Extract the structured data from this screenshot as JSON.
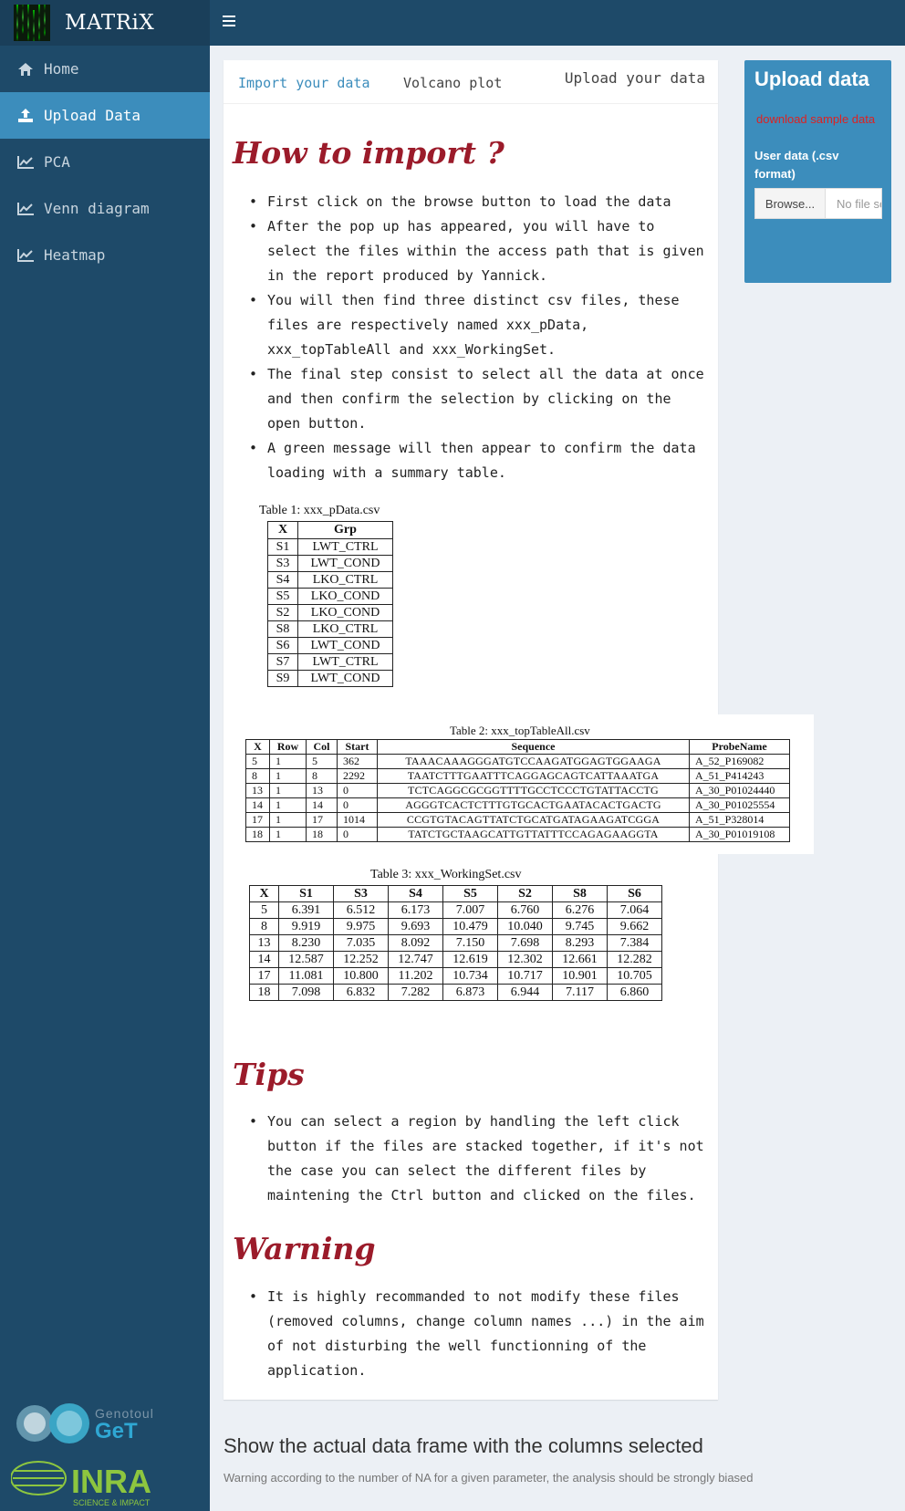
{
  "app": {
    "brand": "MATRiX"
  },
  "sidebar": {
    "items": [
      {
        "label": "Home",
        "icon": "home-icon"
      },
      {
        "label": "Upload Data",
        "icon": "upload-icon"
      },
      {
        "label": "PCA",
        "icon": "line-chart-icon"
      },
      {
        "label": "Venn diagram",
        "icon": "line-chart-icon"
      },
      {
        "label": "Heatmap",
        "icon": "line-chart-icon"
      }
    ],
    "logos": {
      "genotoul_top": "Genotoul",
      "genotoul_bottom": "GeT",
      "inra": "INRA",
      "inra_tag": "SCIENCE & IMPACT"
    }
  },
  "tabs": {
    "items": [
      "Import your data",
      "Volcano plot"
    ],
    "box_title": "Upload your data"
  },
  "howto": {
    "title": "How to import ?",
    "bullets": [
      "First click on the browse button to load the data",
      "After the pop up has appeared, you will have to select the files within the access path that is given in the report produced by Yannick.",
      "You will then find three distinct csv files, these files are respectively named xxx_pData, xxx_topTableAll and xxx_WorkingSet.",
      "The final step consist to select all the data at once and then confirm the selection by clicking on the open button.",
      "A green message will then appear to confirm the data loading with a summary table."
    ]
  },
  "table1": {
    "caption": "Table 1: xxx_pData.csv",
    "headers": [
      "X",
      "Grp"
    ],
    "rows": [
      [
        "S1",
        "LWT_CTRL"
      ],
      [
        "S3",
        "LWT_COND"
      ],
      [
        "S4",
        "LKO_CTRL"
      ],
      [
        "S5",
        "LKO_COND"
      ],
      [
        "S2",
        "LKO_COND"
      ],
      [
        "S8",
        "LKO_CTRL"
      ],
      [
        "S6",
        "LWT_COND"
      ],
      [
        "S7",
        "LWT_CTRL"
      ],
      [
        "S9",
        "LWT_COND"
      ]
    ]
  },
  "table2": {
    "caption": "Table 2: xxx_topTableAll.csv",
    "headers": [
      "X",
      "Row",
      "Col",
      "Start",
      "Sequence",
      "ProbeName"
    ],
    "rows": [
      [
        "5",
        "1",
        "5",
        "362",
        "TAAACAAAGGGATGTCCAAGATGGAGTGGAAGA",
        "A_52_P169082"
      ],
      [
        "8",
        "1",
        "8",
        "2292",
        "TAATCTTTGAATTTCAGGAGCAGTCATTAAATGA",
        "A_51_P414243"
      ],
      [
        "13",
        "1",
        "13",
        "0",
        "TCTCAGGCGCGGTTTTGCCTCCCTGTATTACCTG",
        "A_30_P01024440"
      ],
      [
        "14",
        "1",
        "14",
        "0",
        "AGGGTCACTCTTTGTGCACTGAATACACTGACTG",
        "A_30_P01025554"
      ],
      [
        "17",
        "1",
        "17",
        "1014",
        "CCGTGTACAGTTATCTGCATGATAGAAGATCGGA",
        "A_51_P328014"
      ],
      [
        "18",
        "1",
        "18",
        "0",
        "TATCTGCTAAGCATTGTTATTTCCAGAGAAGGTA",
        "A_30_P01019108"
      ]
    ]
  },
  "table3": {
    "caption": "Table 3: xxx_WorkingSet.csv",
    "headers": [
      "X",
      "S1",
      "S3",
      "S4",
      "S5",
      "S2",
      "S8",
      "S6"
    ],
    "rows": [
      [
        "5",
        "6.391",
        "6.512",
        "6.173",
        "7.007",
        "6.760",
        "6.276",
        "7.064"
      ],
      [
        "8",
        "9.919",
        "9.975",
        "9.693",
        "10.479",
        "10.040",
        "9.745",
        "9.662"
      ],
      [
        "13",
        "8.230",
        "7.035",
        "8.092",
        "7.150",
        "7.698",
        "8.293",
        "7.384"
      ],
      [
        "14",
        "12.587",
        "12.252",
        "12.747",
        "12.619",
        "12.302",
        "12.661",
        "12.282"
      ],
      [
        "17",
        "11.081",
        "10.800",
        "11.202",
        "10.734",
        "10.717",
        "10.901",
        "10.705"
      ],
      [
        "18",
        "7.098",
        "6.832",
        "7.282",
        "6.873",
        "6.944",
        "7.117",
        "6.860"
      ]
    ]
  },
  "tips": {
    "title": "Tips",
    "bullets": [
      "You can select a region by handling the left click button if the files are stacked together, if it's not the case you can select the different files by maintening the Ctrl button and clicked on the files."
    ]
  },
  "warning": {
    "title": "Warning",
    "bullets": [
      "It is highly recommanded to not modify these files (removed columns, change column names ...) in the aim of not disturbing the well functionning of the application."
    ]
  },
  "upload": {
    "title": "Upload data",
    "sample_link": "download sample data",
    "label": "User data (.csv format)",
    "browse": "Browse...",
    "nofile": "No file selected"
  },
  "dataframe": {
    "title": "Show the actual data frame with the columns selected",
    "note": "Warning according to the number of NA for a given parameter, the analysis should be strongly biased"
  },
  "colors": {
    "accent": "#3c8dbc",
    "sidebar": "#1e4a69",
    "heading": "#9b1b2a",
    "link_red": "#dd2222"
  }
}
